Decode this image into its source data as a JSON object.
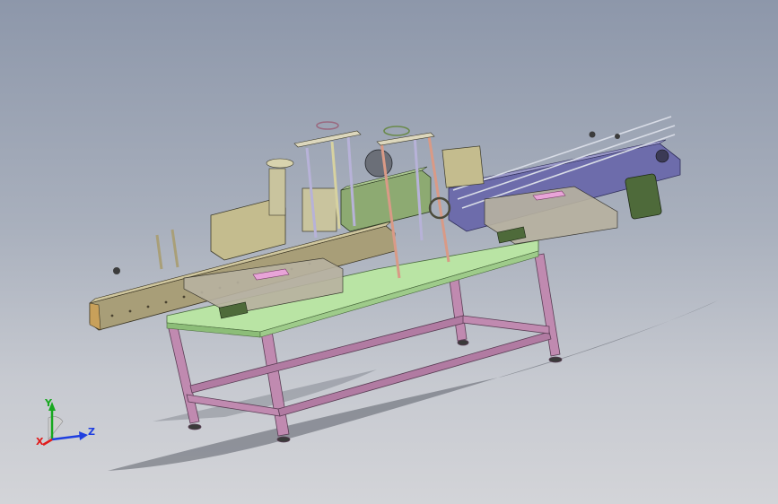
{
  "triad": {
    "x_label": "X",
    "y_label": "Y",
    "z_label": "Z",
    "x_color": "#e01b1b",
    "y_color": "#18a820",
    "z_color": "#1f3fe0"
  },
  "colors": {
    "table_top": "#b9e4a4",
    "table_frame": "#c08ab0",
    "feed_rail": "#a89e78",
    "conveyor_side": "#6d6cab",
    "assembly_block": "#8daa72",
    "head_block": "#c4bc8e",
    "motor": "#4e6a3a",
    "label_pad": "#e8a4d8",
    "rods": "#b7b2d8"
  }
}
